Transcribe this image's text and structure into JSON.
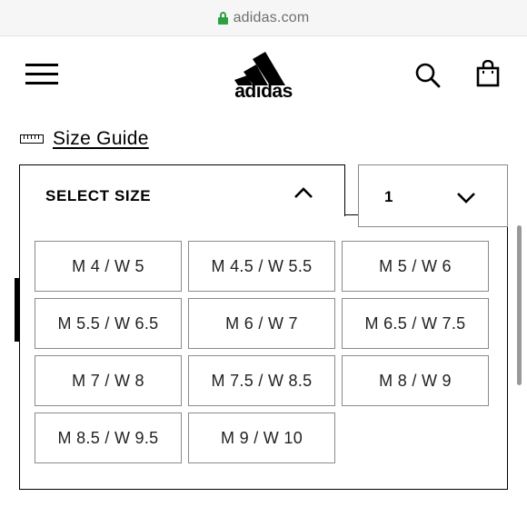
{
  "browser": {
    "url": "adidas.com"
  },
  "header": {
    "menu_icon": "hamburger-menu-icon",
    "logo_text": "adidas",
    "search_icon": "search-icon",
    "bag_icon": "shopping-bag-icon"
  },
  "size_guide": {
    "label": "Size Guide",
    "icon": "ruler-icon"
  },
  "size_select": {
    "label": "SELECT SIZE",
    "expanded": true
  },
  "quantity": {
    "value": "1"
  },
  "sizes": [
    "M 4 / W 5",
    "M 4.5 / W 5.5",
    "M 5 / W 6",
    "M 5.5 / W 6.5",
    "M 6 / W 7",
    "M 6.5 / W 7.5",
    "M 7 / W 8",
    "M 7.5 / W 8.5",
    "M 8 / W 9",
    "M 8.5 / W 9.5",
    "M 9 / W 10"
  ],
  "colors": {
    "lock": "#2ea043",
    "url_text": "#6f6f6f",
    "border": "#8a8a8a"
  }
}
